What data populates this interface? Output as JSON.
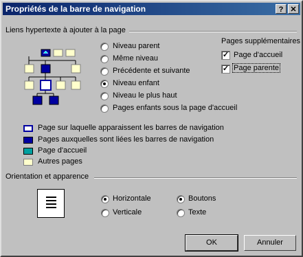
{
  "window": {
    "title": "Propriétés de la barre de navigation",
    "help_label": "?",
    "close_label": "✕"
  },
  "links_group": {
    "label": "Liens hypertexte à ajouter à la page",
    "levels": [
      {
        "label": "Niveau parent",
        "selected": false
      },
      {
        "label": "Même niveau",
        "selected": false
      },
      {
        "label": "Précédente et suivante",
        "selected": false
      },
      {
        "label": "Niveau enfant",
        "selected": true
      },
      {
        "label": "Niveau le plus haut",
        "selected": false
      },
      {
        "label": "Pages enfants sous la page d'accueil",
        "selected": false
      }
    ],
    "additional": {
      "label": "Pages supplémentaires :",
      "items": [
        {
          "label": "Page d'accueil",
          "checked": true
        },
        {
          "label": "Page parente",
          "checked": true
        }
      ]
    }
  },
  "legend": [
    {
      "label": "Page sur laquelle apparaissent les barres de navigation",
      "icon": "outlined-page-icon"
    },
    {
      "label": "Pages auxquelles sont liées les barres de navigation",
      "icon": "linked-page-icon"
    },
    {
      "label": "Page d'accueil",
      "icon": "home-page-icon"
    },
    {
      "label": "Autres pages",
      "icon": "other-page-icon"
    }
  ],
  "orientation_group": {
    "label": "Orientation et apparence",
    "orientation": [
      {
        "label": "Horizontale",
        "selected": true
      },
      {
        "label": "Verticale",
        "selected": false
      }
    ],
    "appearance": [
      {
        "label": "Boutons",
        "selected": true
      },
      {
        "label": "Texte",
        "selected": false
      }
    ]
  },
  "buttons": {
    "ok": "OK",
    "cancel": "Annuler"
  },
  "colors": {
    "title_start": "#0a246a",
    "title_end": "#3a6ea5",
    "page_fill": "#ffffcc",
    "linked_fill": "#0000a0"
  }
}
